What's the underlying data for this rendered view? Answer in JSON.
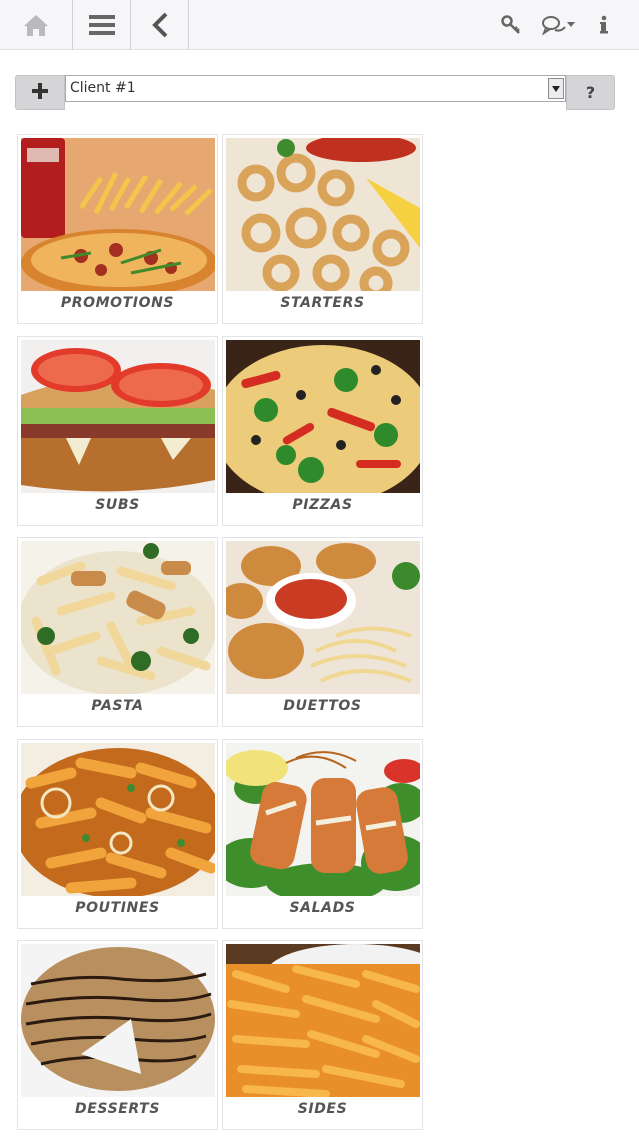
{
  "nav": {
    "home_icon": "home-icon",
    "menu_icon": "hamburger-menu-icon",
    "back_icon": "chevron-left-icon",
    "key_icon": "key-icon",
    "chat_icon": "chat-bubbles-icon",
    "info_icon": "info-icon"
  },
  "client": {
    "add_label": "+",
    "selected": "Client #1",
    "help_label": "?"
  },
  "categories": [
    {
      "label": "PROMOTIONS"
    },
    {
      "label": "STARTERS"
    },
    {
      "label": "SUBS"
    },
    {
      "label": "PIZZAS"
    },
    {
      "label": "PASTA"
    },
    {
      "label": "DUETTOS"
    },
    {
      "label": "POUTINES"
    },
    {
      "label": "SALADS"
    },
    {
      "label": "DESSERTS"
    },
    {
      "label": "SIDES"
    }
  ],
  "colors": {
    "topbar": "#f6f6f8",
    "button_gray": "#d5d5d8",
    "label_text": "#555555"
  }
}
